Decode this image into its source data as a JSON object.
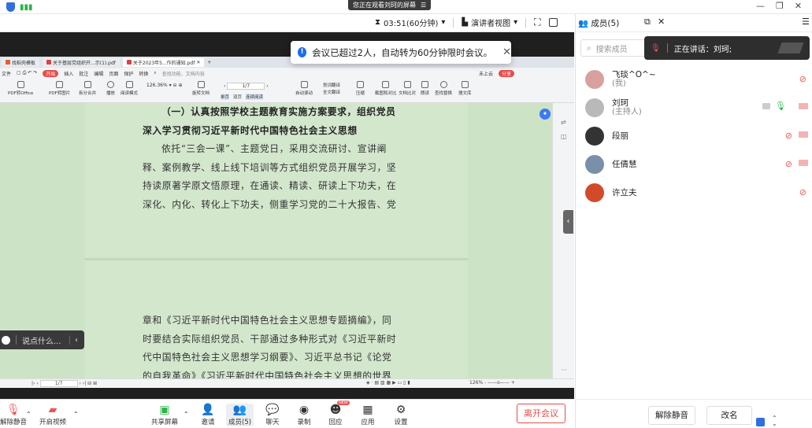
{
  "top": {
    "banner_text": "您正在观看刘珂的屏幕",
    "timer": "03:51(60分钟)",
    "view_mode": "演讲者视图",
    "members_title": "成员(5)"
  },
  "toast": {
    "text": "会议已超过2人，自动转为60分钟限时会议。"
  },
  "wps": {
    "tabs": [
      "找稻壳模板",
      "关于基层党组织开...示(1).pdf",
      "关于2023年5...作的通知.pdf"
    ],
    "menu": [
      "文件",
      "开始",
      "插入",
      "批注",
      "编辑",
      "页面",
      "保护",
      "转换",
      "查找功能、文档内容"
    ],
    "menu_right": [
      "未上云",
      "分享"
    ],
    "tools": [
      "PDF转Office",
      "PDF转图片",
      "拆分合并",
      "播放",
      "阅读模式",
      "旋转文档",
      "单页",
      "双页",
      "连续阅读",
      "自动滚动",
      "划词翻译",
      "全文翻译",
      "压缩",
      "截图和对比",
      "文档比对",
      "朗读",
      "查找替换",
      "搜文库"
    ],
    "zoom": "126.36%",
    "page_indicator": "1/7",
    "status_page": "1/7",
    "status_zoom": "126%"
  },
  "doc": {
    "heading_lines": [
      "（一）认真按照学校主题教育实施方案要求，组织党员",
      "深入学习贯彻习近平新时代中国特色社会主义思想"
    ],
    "p1_lines": [
      "依托“三会一课”、主题党日，采用交流研讨、宣讲阐",
      "释、案例教学、线上线下培训等方式组织党员开展学习，坚",
      "持读原著学原文悟原理，在通读、精读、研读上下功夫，在",
      "深化、内化、转化上下功夫，侧重学习党的二十大报告、党"
    ],
    "p2_lines": [
      "章和《习近平新时代中国特色社会主义思想专题摘编》，同",
      "时要结合实际组织党员、干部通过多种形式对《习近平新时",
      "代中国特色社会主义思想学习纲要》、习近平总书记《论党",
      "的自我革命》《习近平新时代中国特色社会主义思想的世界"
    ]
  },
  "chat_float": {
    "placeholder": "说点什么..."
  },
  "bottom": {
    "mute": "解除静音",
    "video": "开启视频",
    "share": "共享屏幕",
    "invite": "邀请",
    "members": "成员(5)",
    "chat": "聊天",
    "record": "录制",
    "reply": "回应",
    "apps": "应用",
    "settings": "设置",
    "leave": "离开会议",
    "new_badge": "NEW"
  },
  "panel": {
    "search_placeholder": "搜索成员",
    "speaking_label": "正在讲话：刘珂;",
    "members": [
      {
        "name": "飞琰^O^~",
        "role": "(我)",
        "color": "#d9a0a0"
      },
      {
        "name": "刘珂",
        "role": "(主持人)",
        "color": "#b9b9b9"
      },
      {
        "name": "段丽",
        "role": "",
        "color": "#333333"
      },
      {
        "name": "任倩慧",
        "role": "",
        "color": "#7a8fa8"
      },
      {
        "name": "许立夫",
        "role": "",
        "color": "#d14b2b"
      }
    ],
    "unmute_all": "解除静音",
    "rename": "改名"
  }
}
